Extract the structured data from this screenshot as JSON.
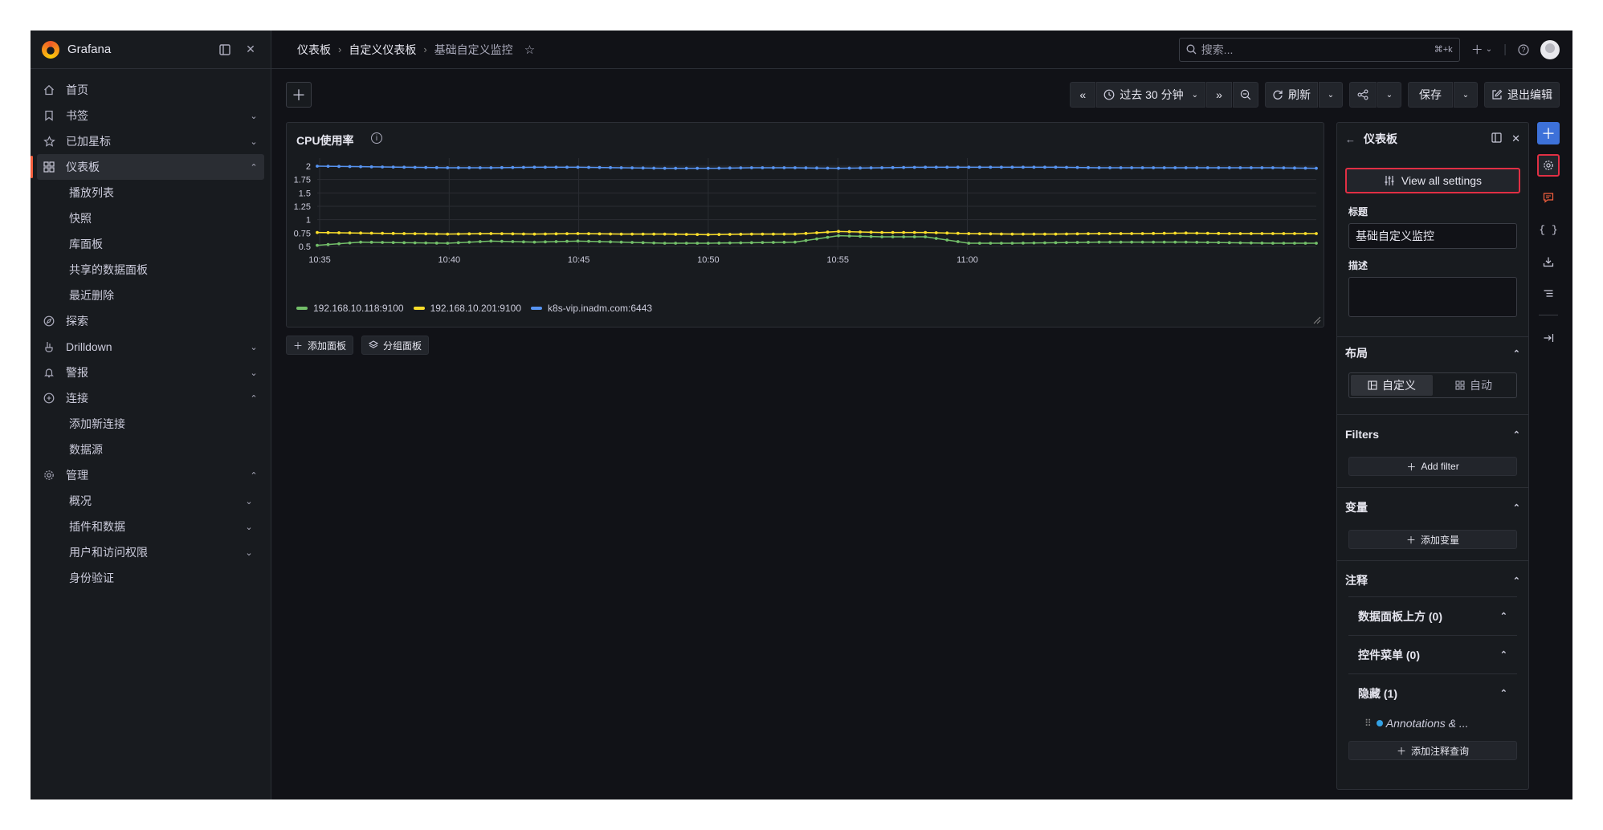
{
  "app": {
    "name": "Grafana"
  },
  "sidebar": {
    "items": [
      {
        "label": "首页",
        "icon": "home-icon",
        "chevron": ""
      },
      {
        "label": "书签",
        "icon": "bookmark-icon",
        "chevron": "⌄"
      },
      {
        "label": "已加星标",
        "icon": "star-icon",
        "chevron": "⌄"
      },
      {
        "label": "仪表板",
        "icon": "dashboards-icon",
        "chevron": "⌃",
        "active": true
      },
      {
        "label": "播放列表",
        "sub": true
      },
      {
        "label": "快照",
        "sub": true
      },
      {
        "label": "库面板",
        "sub": true
      },
      {
        "label": "共享的数据面板",
        "sub": true
      },
      {
        "label": "最近删除",
        "sub": true
      },
      {
        "label": "探索",
        "icon": "compass-icon",
        "chevron": ""
      },
      {
        "label": "Drilldown",
        "icon": "drilldown-icon",
        "chevron": "⌄"
      },
      {
        "label": "警报",
        "icon": "bell-icon",
        "chevron": "⌄"
      },
      {
        "label": "连接",
        "icon": "link-icon",
        "chevron": "⌃"
      },
      {
        "label": "添加新连接",
        "sub": true
      },
      {
        "label": "数据源",
        "sub": true
      },
      {
        "label": "管理",
        "icon": "cog-icon",
        "chevron": "⌃"
      },
      {
        "label": "概况",
        "sub": true,
        "chevron": "⌄"
      },
      {
        "label": "插件和数据",
        "sub": true,
        "chevron": "⌄"
      },
      {
        "label": "用户和访问权限",
        "sub": true,
        "chevron": "⌄"
      },
      {
        "label": "身份验证",
        "sub": true
      }
    ]
  },
  "breadcrumb": {
    "items": [
      "仪表板",
      "自定义仪表板",
      "基础自定义监控"
    ]
  },
  "search": {
    "placeholder": "搜索...",
    "shortcut": "⌘+k"
  },
  "toolbar": {
    "time_range": "过去 30 分钟",
    "refresh": "刷新",
    "save": "保存",
    "exit_edit": "退出编辑"
  },
  "panel": {
    "title": "CPU使用率"
  },
  "actions": {
    "add_panel": "添加面板",
    "group_panel": "分组面板"
  },
  "chart_data": {
    "type": "line",
    "title": "CPU使用率",
    "x": [
      "10:35",
      "10:40",
      "10:45",
      "10:50",
      "10:55",
      "11:00"
    ],
    "y_ticks": [
      "0.5",
      "0.75",
      "1",
      "1.25",
      "1.5",
      "1.75",
      "2"
    ],
    "ylim": [
      0.5,
      2
    ],
    "series": [
      {
        "name": "192.168.10.118:9100",
        "color": "#73bf69",
        "values": [
          0.52,
          0.58,
          0.57,
          0.56,
          0.6,
          0.58,
          0.6,
          0.58,
          0.56,
          0.56,
          0.57,
          0.58,
          0.7,
          0.68,
          0.68,
          0.56,
          0.56,
          0.57,
          0.58,
          0.58,
          0.58,
          0.57,
          0.56,
          0.56
        ]
      },
      {
        "name": "192.168.10.201:9100",
        "color": "#fade2a",
        "values": [
          0.76,
          0.75,
          0.74,
          0.73,
          0.74,
          0.73,
          0.74,
          0.73,
          0.73,
          0.72,
          0.73,
          0.73,
          0.78,
          0.76,
          0.76,
          0.74,
          0.73,
          0.73,
          0.74,
          0.74,
          0.75,
          0.74,
          0.74,
          0.74
        ]
      },
      {
        "name": "k8s-vip.inadm.com:6443",
        "color": "#5794f2",
        "values": [
          2.0,
          1.99,
          1.98,
          1.97,
          1.97,
          1.98,
          1.98,
          1.97,
          1.96,
          1.96,
          1.97,
          1.97,
          1.96,
          1.97,
          1.98,
          1.98,
          1.98,
          1.98,
          1.97,
          1.97,
          1.97,
          1.97,
          1.97,
          1.96
        ]
      }
    ],
    "grid": true,
    "legend": "bottom-left"
  },
  "pane": {
    "title": "仪表板",
    "view_all": "View all settings",
    "title_label": "标题",
    "title_value": "基础自定义监控",
    "desc_label": "描述",
    "layout": {
      "heading": "布局",
      "opt_custom": "自定义",
      "opt_auto": "自动"
    },
    "filters": {
      "heading": "Filters",
      "add": "Add filter"
    },
    "variables": {
      "heading": "变量",
      "add": "添加变量"
    },
    "annotations": {
      "heading": "注释",
      "above": "数据面板上方 (0)",
      "controls": "控件菜单 (0)",
      "hidden": "隐藏 (1)",
      "item": "Annotations & ...",
      "add": "添加注释查询"
    }
  }
}
